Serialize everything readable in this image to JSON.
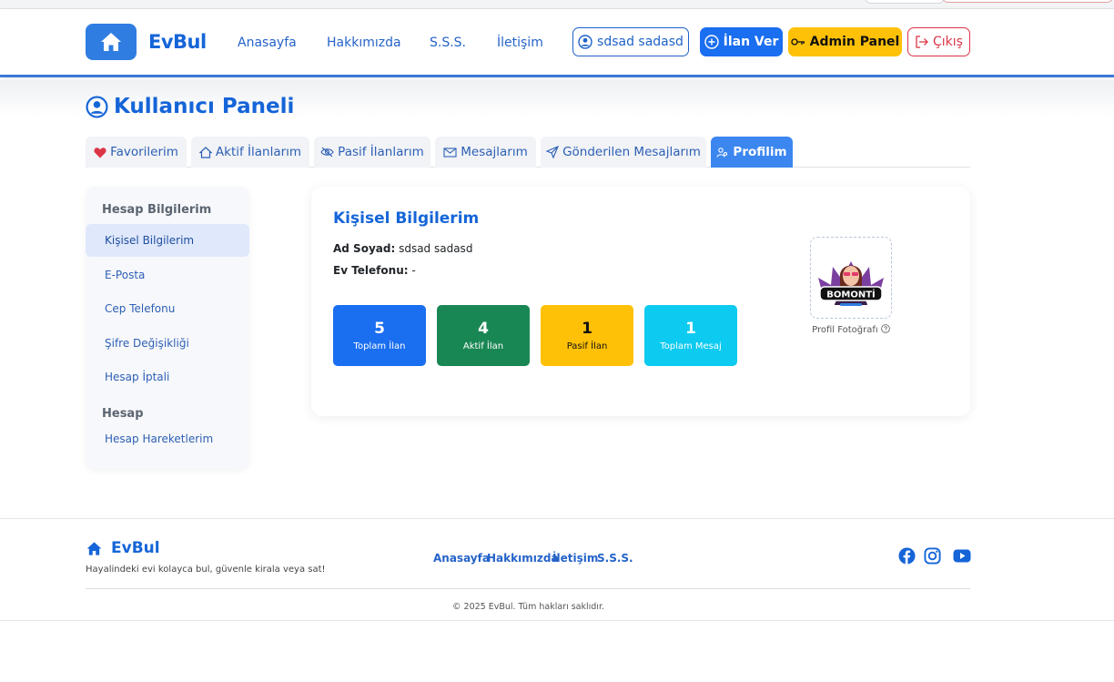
{
  "header": {
    "brand": "EvBul",
    "nav": [
      "Anasayfa",
      "Hakkımızda",
      "S.S.S.",
      "İletişim"
    ],
    "user_label": "sdsad sadasd",
    "post_listing_label": "İlan Ver",
    "admin_label": "Admin Panel",
    "logout_label": "Çıkış"
  },
  "page": {
    "title": "Kullanıcı Paneli"
  },
  "tabs": [
    "Favorilerim",
    "Aktif İlanlarım",
    "Pasif İlanlarım",
    "Mesajlarım",
    "Gönderilen Mesajlarım",
    "Profilim"
  ],
  "sidebar": {
    "section1": "Hesap Bilgilerim",
    "items1": [
      "Kişisel Bilgilerim",
      "E-Posta",
      "Cep Telefonu",
      "Şifre Değişikliği",
      "Hesap İptali"
    ],
    "section2": "Hesap",
    "items2": [
      "Hesap Hareketlerim"
    ]
  },
  "profile": {
    "title": "Kişisel Bilgilerim",
    "name_label": "Ad Soyad:",
    "name_value": "sdsad sadasd",
    "phone_label": "Ev Telefonu:",
    "phone_value": "-",
    "photo_caption": "Profil Fotoğrafı",
    "avatar_text": "BOMONTİ"
  },
  "stats": [
    {
      "value": "5",
      "label": "Toplam İlan",
      "color": "#1a6ef0"
    },
    {
      "value": "4",
      "label": "Aktif İlan",
      "color": "#198754"
    },
    {
      "value": "1",
      "label": "Pasif İlan",
      "color": "#ffc107"
    },
    {
      "value": "1",
      "label": "Toplam Mesaj",
      "color": "#0dcaf0"
    }
  ],
  "footer": {
    "brand": "EvBul",
    "tagline": "Hayalindeki evi kolayca bul, güvenle kirala veya sat!",
    "links": [
      "Anasayfa",
      "Hakkımızda",
      "İletişim",
      "S.S.S."
    ],
    "social": [
      "facebook-icon",
      "instagram-icon",
      "youtube-icon"
    ],
    "copyright": "© 2025 EvBul. Tüm hakları saklıdır."
  },
  "colors": {
    "primary": "#1565d8",
    "accent": "#3a78d8",
    "warning": "#ffc107",
    "danger": "#dc3545"
  }
}
